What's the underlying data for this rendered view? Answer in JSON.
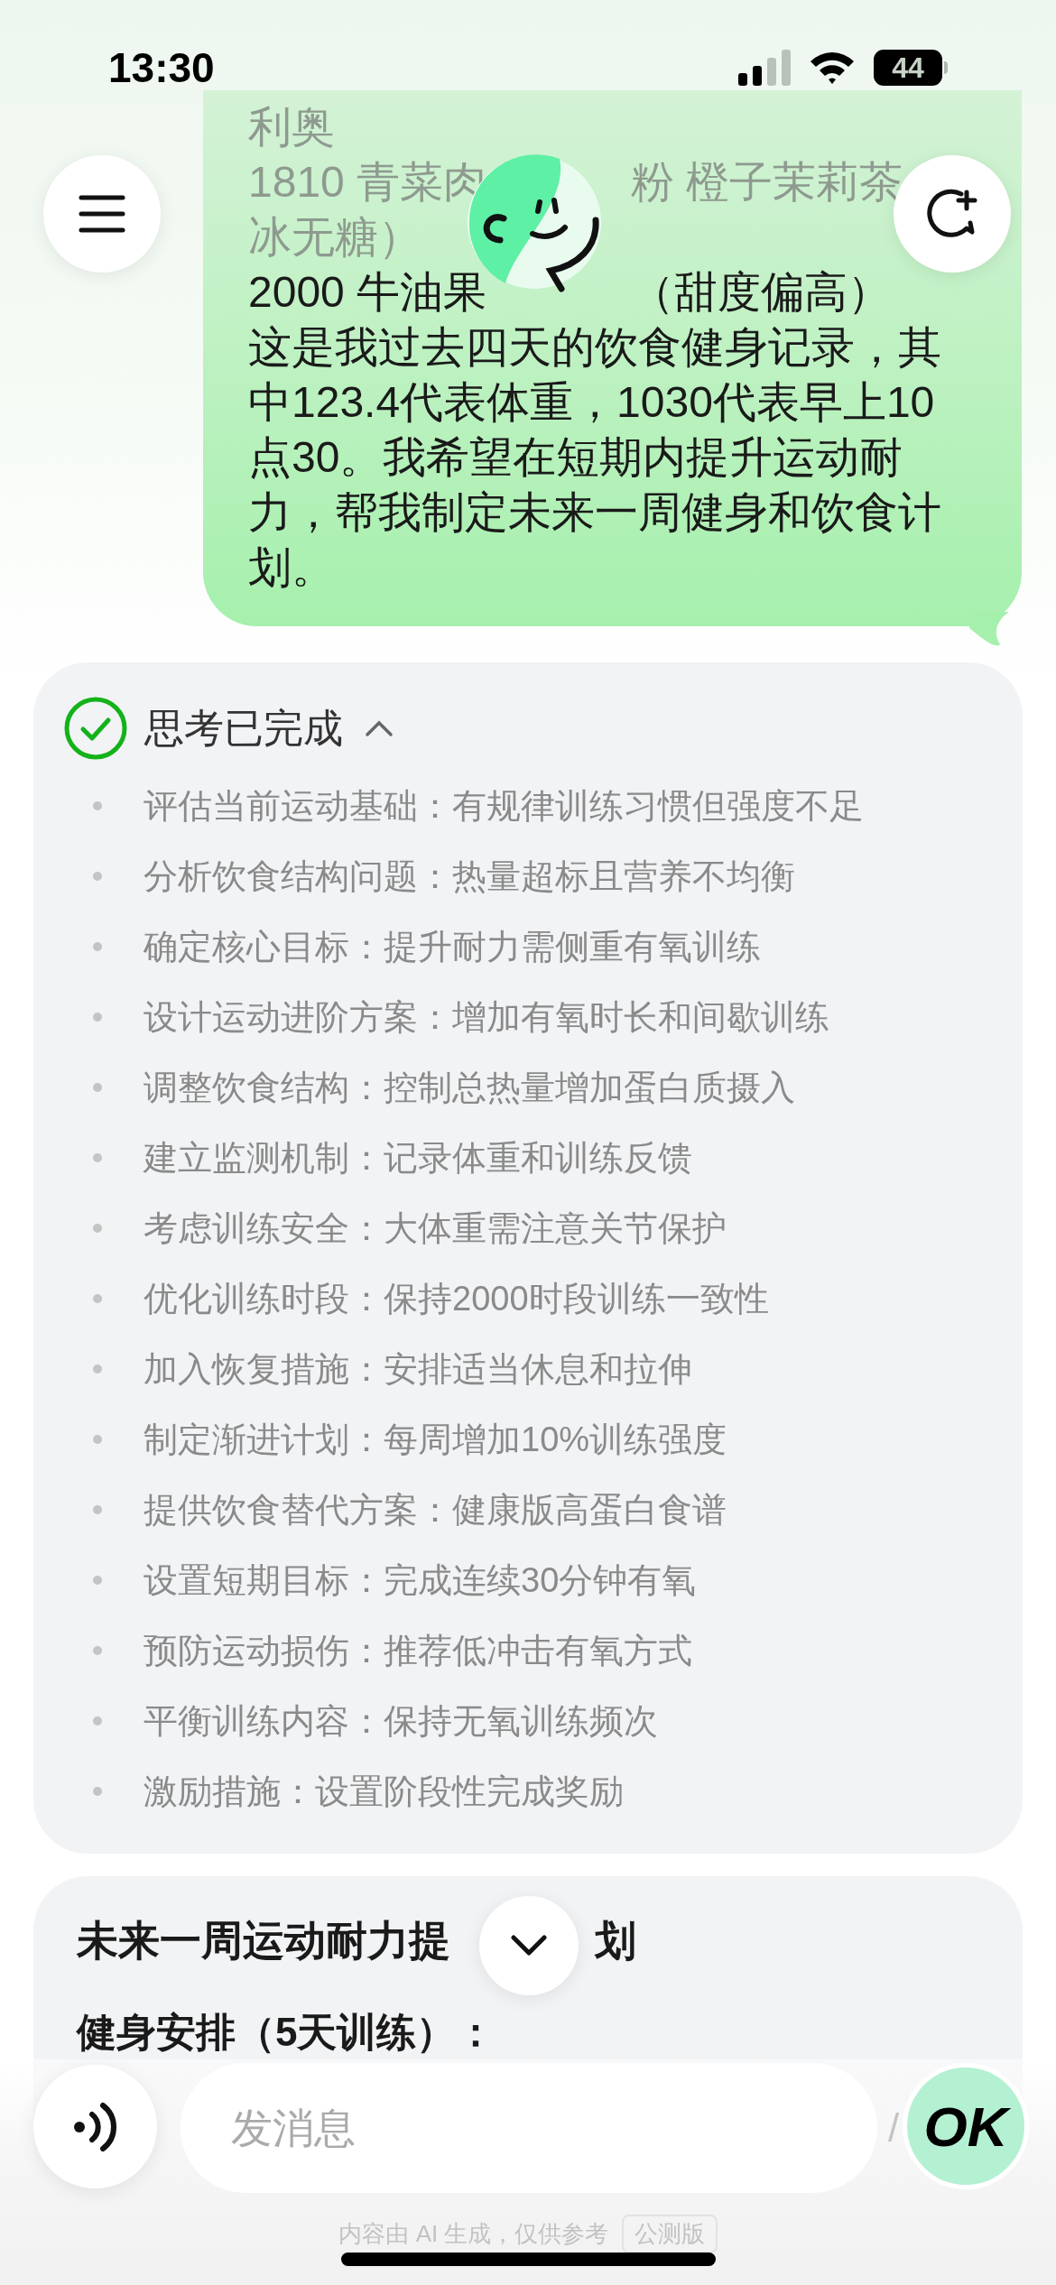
{
  "status_bar": {
    "time": "13:30",
    "battery": "44"
  },
  "user_message": {
    "lines": [
      {
        "faded": true,
        "segments": [
          "利奥"
        ]
      },
      {
        "faded": true,
        "segments": [
          "1810 青菜肉",
          "粉 橙子茉莉茶"
        ]
      },
      {
        "faded": true,
        "segments": [
          "冰无糖）"
        ]
      },
      {
        "faded": false,
        "segments": [
          "2000 牛油果",
          "（甜度偏高）"
        ]
      }
    ],
    "text": "这是我过去四天的饮食健身记录，其中123.4代表体重，1030代表早上10点30。我希望在短期内提升运动耐力，帮我制定未来一周健身和饮食计划。"
  },
  "thinking": {
    "title": "思考已完成",
    "expanded": true,
    "steps": [
      "评估当前运动基础：有规律训练习惯但强度不足",
      "分析饮食结构问题：热量超标且营养不均衡",
      "确定核心目标：提升耐力需侧重有氧训练",
      "设计运动进阶方案：增加有氧时长和间歇训练",
      "调整饮食结构：控制总热量增加蛋白质摄入",
      "建立监测机制：记录体重和训练反馈",
      "考虑训练安全：大体重需注意关节保护",
      "优化训练时段：保持2000时段训练一致性",
      "加入恢复措施：安排适当休息和拉伸",
      "制定渐进计划：每周增加10%训练强度",
      "提供饮食替代方案：健康版高蛋白食谱",
      "设置短期目标：完成连续30分钟有氧",
      "预防运动损伤：推荐低冲击有氧方式",
      "平衡训练内容：保持无氧训练频次",
      "激励措施：设置阶段性完成奖励"
    ]
  },
  "answer": {
    "title_parts": [
      "未来一周运动耐力提",
      "划"
    ],
    "heading": "健身安排（5天训练）：",
    "peek_right": "/"
  },
  "composer": {
    "placeholder": "发消息",
    "send_label": "OK"
  },
  "footer": {
    "disclaimer": "内容由 AI 生成，仅供参考",
    "badge": "公测版"
  }
}
